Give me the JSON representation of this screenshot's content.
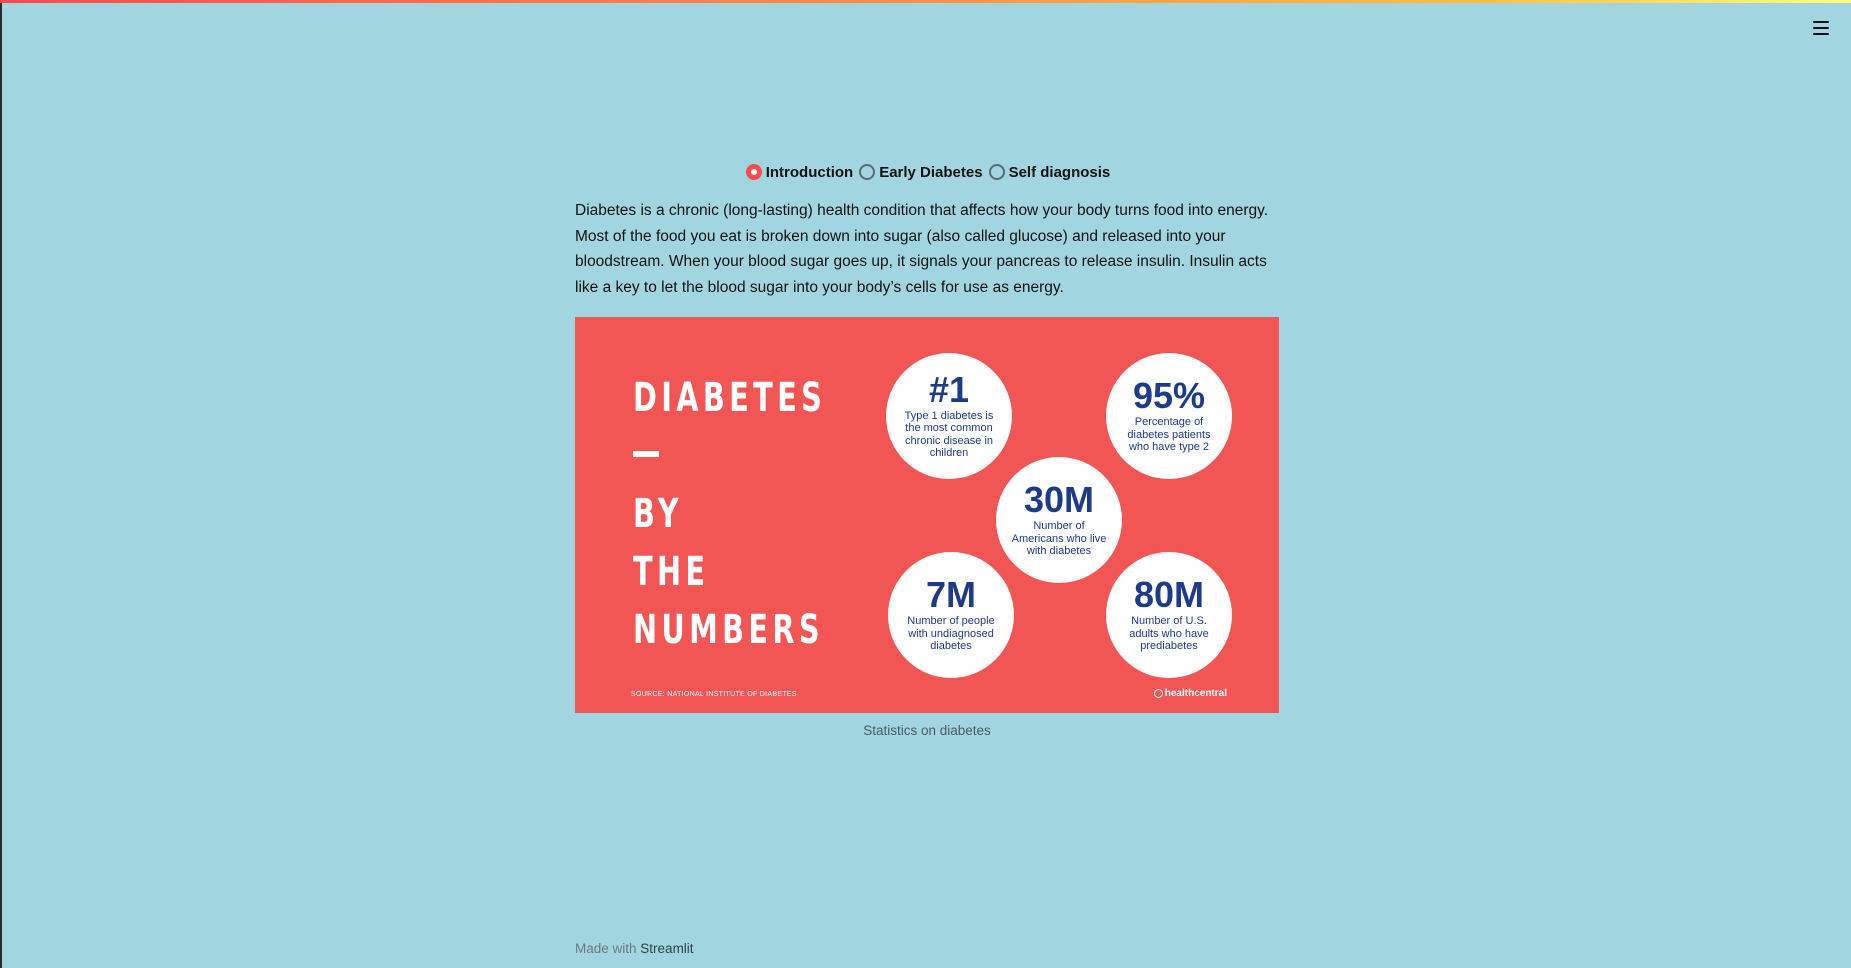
{
  "nav": {
    "radio_options": [
      "Introduction",
      "Early Diabetes",
      "Self diagnosis"
    ],
    "selected": "Introduction"
  },
  "intro": {
    "text": "Diabetes is a chronic (long-lasting) health condition that affects how your body turns food into energy. Most of the food you eat is broken down into sugar (also called glucose) and released into your bloodstream. When your blood sugar goes up, it signals your pancreas to release insulin. Insulin acts like a key to let the blood sugar into your body’s cells for use as energy."
  },
  "infographic": {
    "title_lines": [
      "DIABETES",
      "BY",
      "THE",
      "NUMBERS"
    ],
    "source": "SOURCE: NATIONAL INSTITUTE OF DIABETES",
    "logo": "healthcentral",
    "stats": [
      {
        "value": "#1",
        "desc": "Type 1 diabetes is the most common chronic disease in children"
      },
      {
        "value": "95%",
        "desc": "Percentage of diabetes patients who have type 2"
      },
      {
        "value": "30M",
        "desc": "Number of Americans who live with diabetes"
      },
      {
        "value": "7M",
        "desc": "Number of people with undiagnosed diabetes"
      },
      {
        "value": "80M",
        "desc": "Number of U.S. adults who have prediabetes"
      }
    ],
    "caption": "Statistics on diabetes"
  },
  "footer": {
    "prefix": "Made with",
    "link": "Streamlit"
  },
  "colors": {
    "background": "#a1d6e0",
    "accent": "#ff4b4b",
    "infographic_bg": "#f15654",
    "stat_text": "#1e3b8a"
  }
}
